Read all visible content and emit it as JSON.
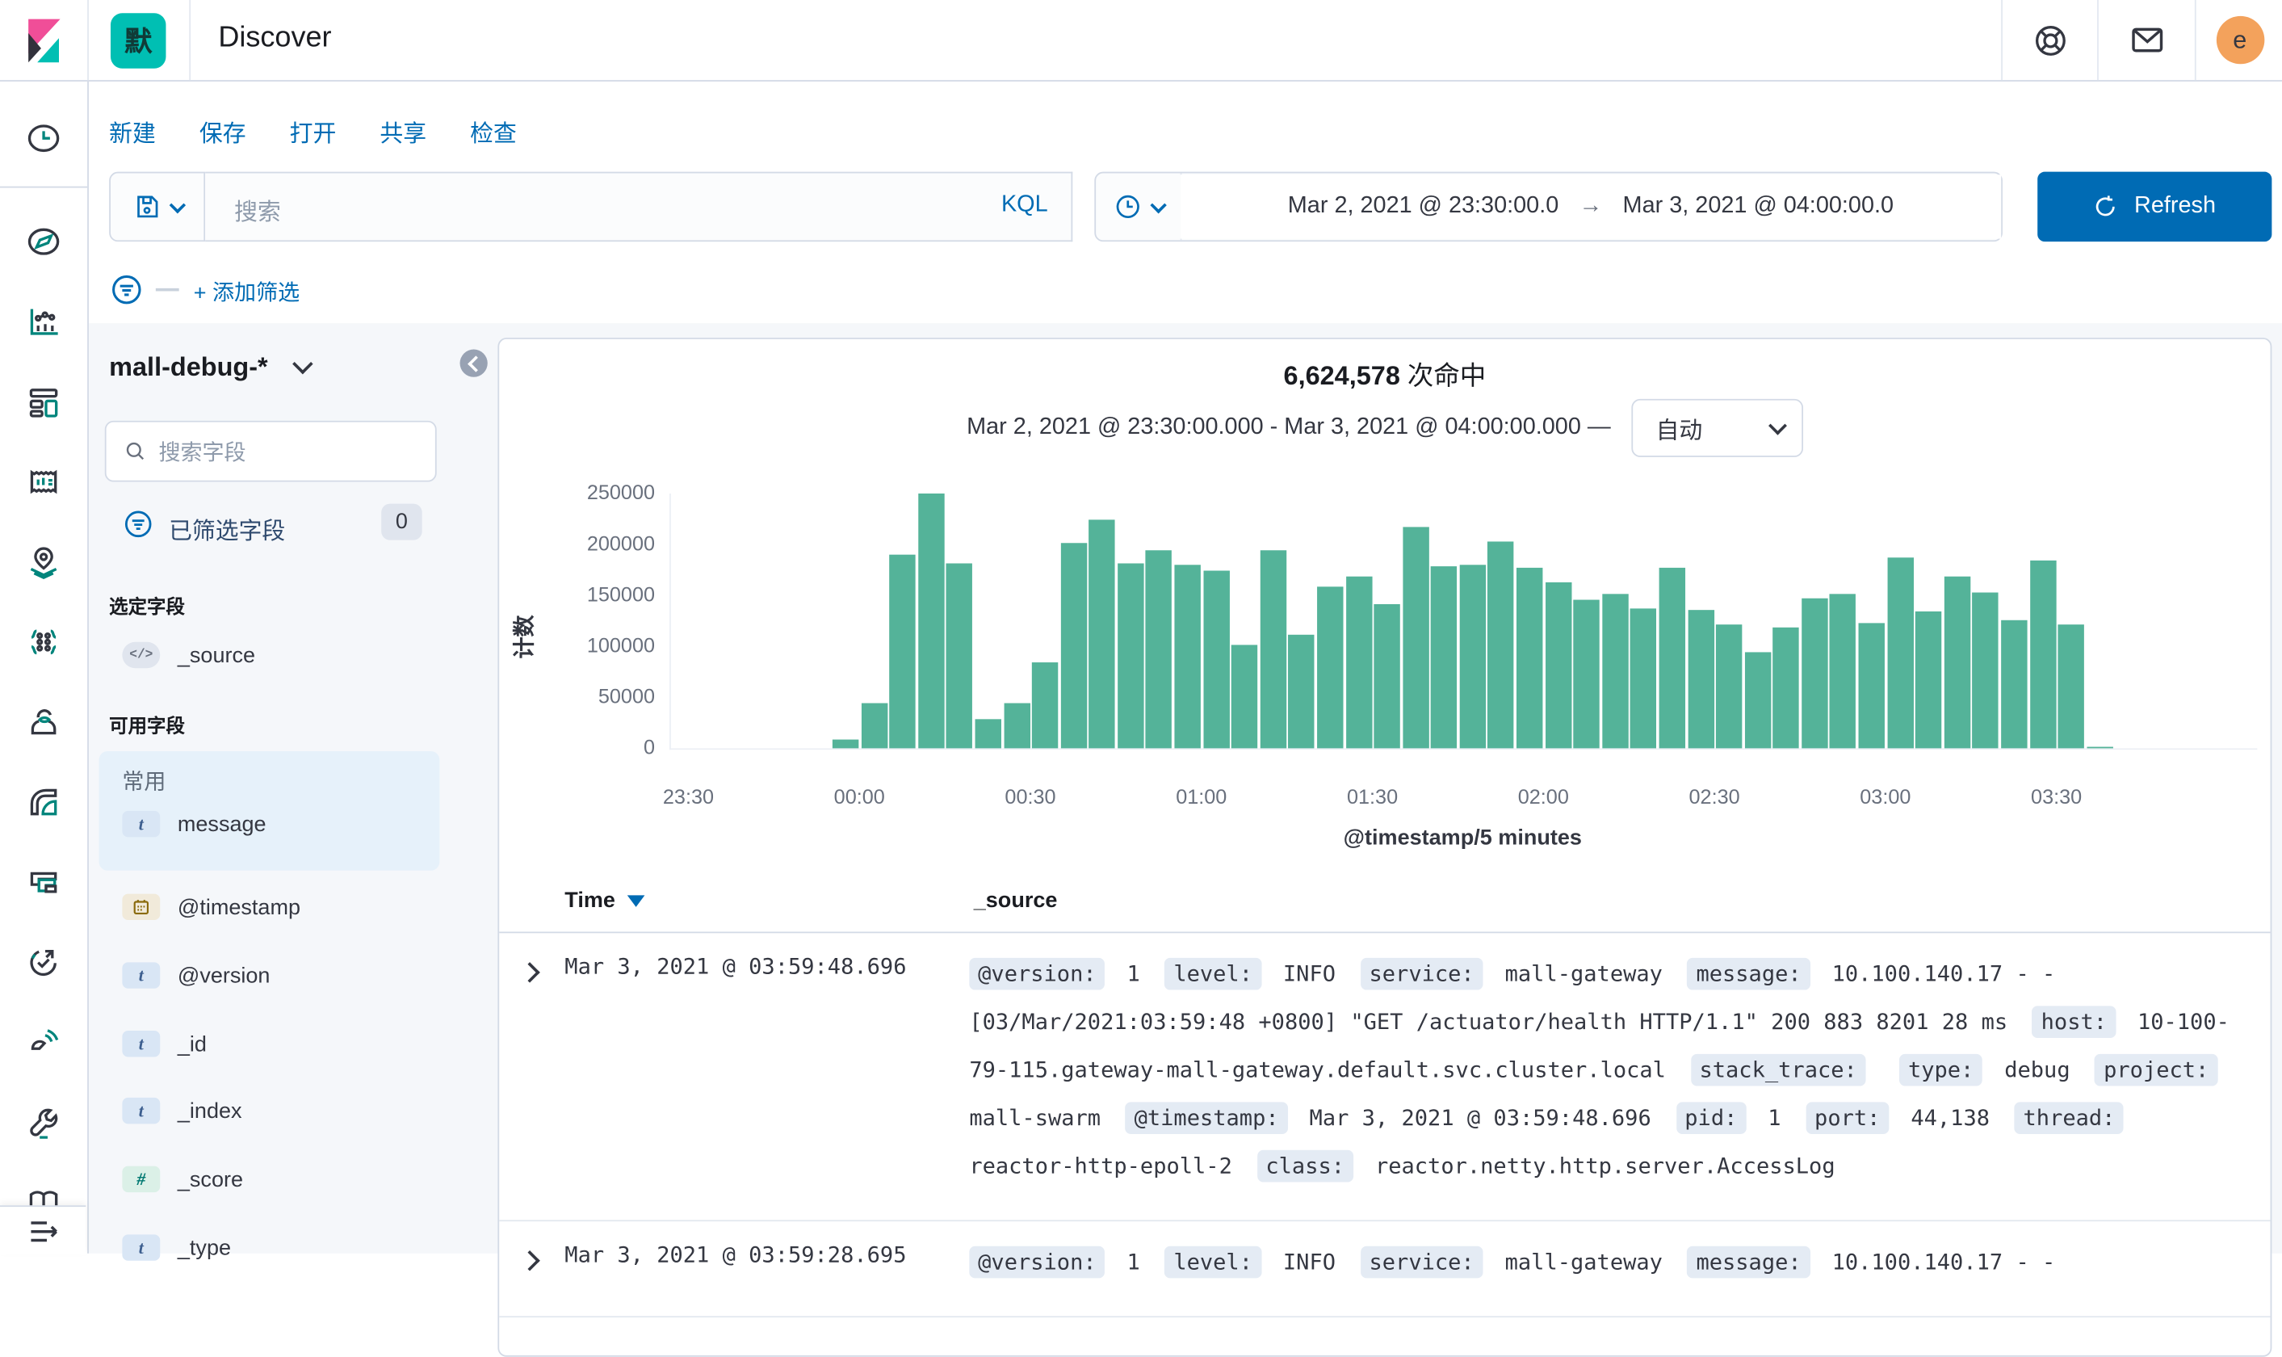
{
  "header": {
    "app_title": "Discover",
    "space_badge": "默",
    "avatar_initial": "e"
  },
  "toolbar": {
    "menu_items": [
      "新建",
      "保存",
      "打开",
      "共享",
      "检查"
    ],
    "search_placeholder": "搜索",
    "kql_label": "KQL",
    "time_range_start": "Mar 2, 2021 @ 23:30:00.0",
    "time_range_arrow": "→",
    "time_range_end": "Mar 3, 2021 @ 04:00:00.0",
    "refresh_label": "Refresh"
  },
  "filter_bar": {
    "add_filter_label": "+ 添加筛选"
  },
  "nav_rail": {
    "icons": [
      "recently-viewed",
      "discover",
      "visualize",
      "dashboard",
      "canvas",
      "maps",
      "machine-learning",
      "enterprise-search",
      "logs",
      "metrics",
      "uptime",
      "apm",
      "dev-tools",
      "stack-management",
      "expand-menu"
    ]
  },
  "sidebar": {
    "index_pattern": "mall-debug-*",
    "field_search_placeholder": "搜索字段",
    "filtered_fields_label": "已筛选字段",
    "filtered_fields_count": "0",
    "selected_fields_label": "选定字段",
    "selected_fields": [
      {
        "name": "_source",
        "type": "source"
      }
    ],
    "available_fields_label": "可用字段",
    "popular_label": "常用",
    "popular_fields": [
      {
        "name": "message",
        "type": "string"
      }
    ],
    "available_fields": [
      {
        "name": "@timestamp",
        "type": "date"
      },
      {
        "name": "@version",
        "type": "string"
      },
      {
        "name": "_id",
        "type": "string"
      },
      {
        "name": "_index",
        "type": "string"
      },
      {
        "name": "_score",
        "type": "number"
      },
      {
        "name": "_type",
        "type": "string"
      }
    ]
  },
  "chart_data": {
    "type": "bar",
    "title": "6,624,578 次命中",
    "hits_number": "6,624,578",
    "hits_suffix": " 次命中",
    "subtitle": "Mar 2, 2021 @ 23:30:00.000 - Mar 3, 2021 @ 04:00:00.000 —",
    "interval_label": "自动",
    "ylabel": "计数",
    "xlabel": "@timestamp/5 minutes",
    "ylim": [
      0,
      250000
    ],
    "yticks": [
      0,
      50000,
      100000,
      150000,
      200000,
      250000
    ],
    "xticks": [
      "23:30",
      "00:00",
      "00:30",
      "01:00",
      "01:30",
      "02:00",
      "02:30",
      "03:00",
      "03:30"
    ],
    "x": [
      "23:55",
      "00:00",
      "00:05",
      "00:10",
      "00:15",
      "00:20",
      "00:25",
      "00:30",
      "00:35",
      "00:40",
      "00:45",
      "00:50",
      "00:55",
      "01:00",
      "01:05",
      "01:10",
      "01:15",
      "01:20",
      "01:25",
      "01:30",
      "01:35",
      "01:40",
      "01:45",
      "01:50",
      "01:55",
      "02:00",
      "02:05",
      "02:10",
      "02:15",
      "02:20",
      "02:25",
      "02:30",
      "02:35",
      "02:40",
      "02:45",
      "02:50",
      "02:55",
      "03:00",
      "03:05",
      "03:10",
      "03:15",
      "03:20",
      "03:25",
      "03:30",
      "03:35"
    ],
    "values": [
      8000,
      44000,
      190000,
      250000,
      182000,
      28000,
      44000,
      85000,
      202000,
      224000,
      181000,
      195000,
      180000,
      175000,
      102000,
      195000,
      112000,
      158000,
      169000,
      142000,
      217000,
      178000,
      180000,
      203000,
      177000,
      163000,
      146000,
      151000,
      137000,
      177000,
      136000,
      121000,
      94000,
      119000,
      147000,
      151000,
      123000,
      187000,
      134000,
      168000,
      153000,
      126000,
      185000,
      122000,
      2000
    ],
    "bar_color": "#54B399",
    "legend": "off",
    "grid": "off"
  },
  "table": {
    "time_header": "Time",
    "source_header": "_source",
    "rows": [
      {
        "time": "Mar 3, 2021 @ 03:59:48.696",
        "source": [
          {
            "field": "@version",
            "value": "1"
          },
          {
            "field": "level",
            "value": "INFO"
          },
          {
            "field": "service",
            "value": "mall-gateway"
          },
          {
            "field": "message",
            "value": "10.100.140.17 - - [03/Mar/2021:03:59:48 +0800] \"GET /actuator/health HTTP/1.1\" 200 883 8201 28 ms"
          },
          {
            "field": "host",
            "value": "10-100-79-115.gateway-mall-gateway.default.svc.cluster.local"
          },
          {
            "field": "stack_trace",
            "value": ""
          },
          {
            "field": "type",
            "value": "debug"
          },
          {
            "field": "project",
            "value": "mall-swarm"
          },
          {
            "field": "@timestamp",
            "value": "Mar 3, 2021 @ 03:59:48.696"
          },
          {
            "field": "pid",
            "value": "1"
          },
          {
            "field": "port",
            "value": "44,138"
          },
          {
            "field": "thread",
            "value": "reactor-http-epoll-2"
          },
          {
            "field": "class",
            "value": "reactor.netty.http.server.AccessLog"
          }
        ]
      },
      {
        "time": "Mar 3, 2021 @ 03:59:28.695",
        "source": [
          {
            "field": "@version",
            "value": "1"
          },
          {
            "field": "level",
            "value": "INFO"
          },
          {
            "field": "service",
            "value": "mall-gateway"
          },
          {
            "field": "message",
            "value": "10.100.140.17 - -"
          }
        ]
      }
    ]
  }
}
